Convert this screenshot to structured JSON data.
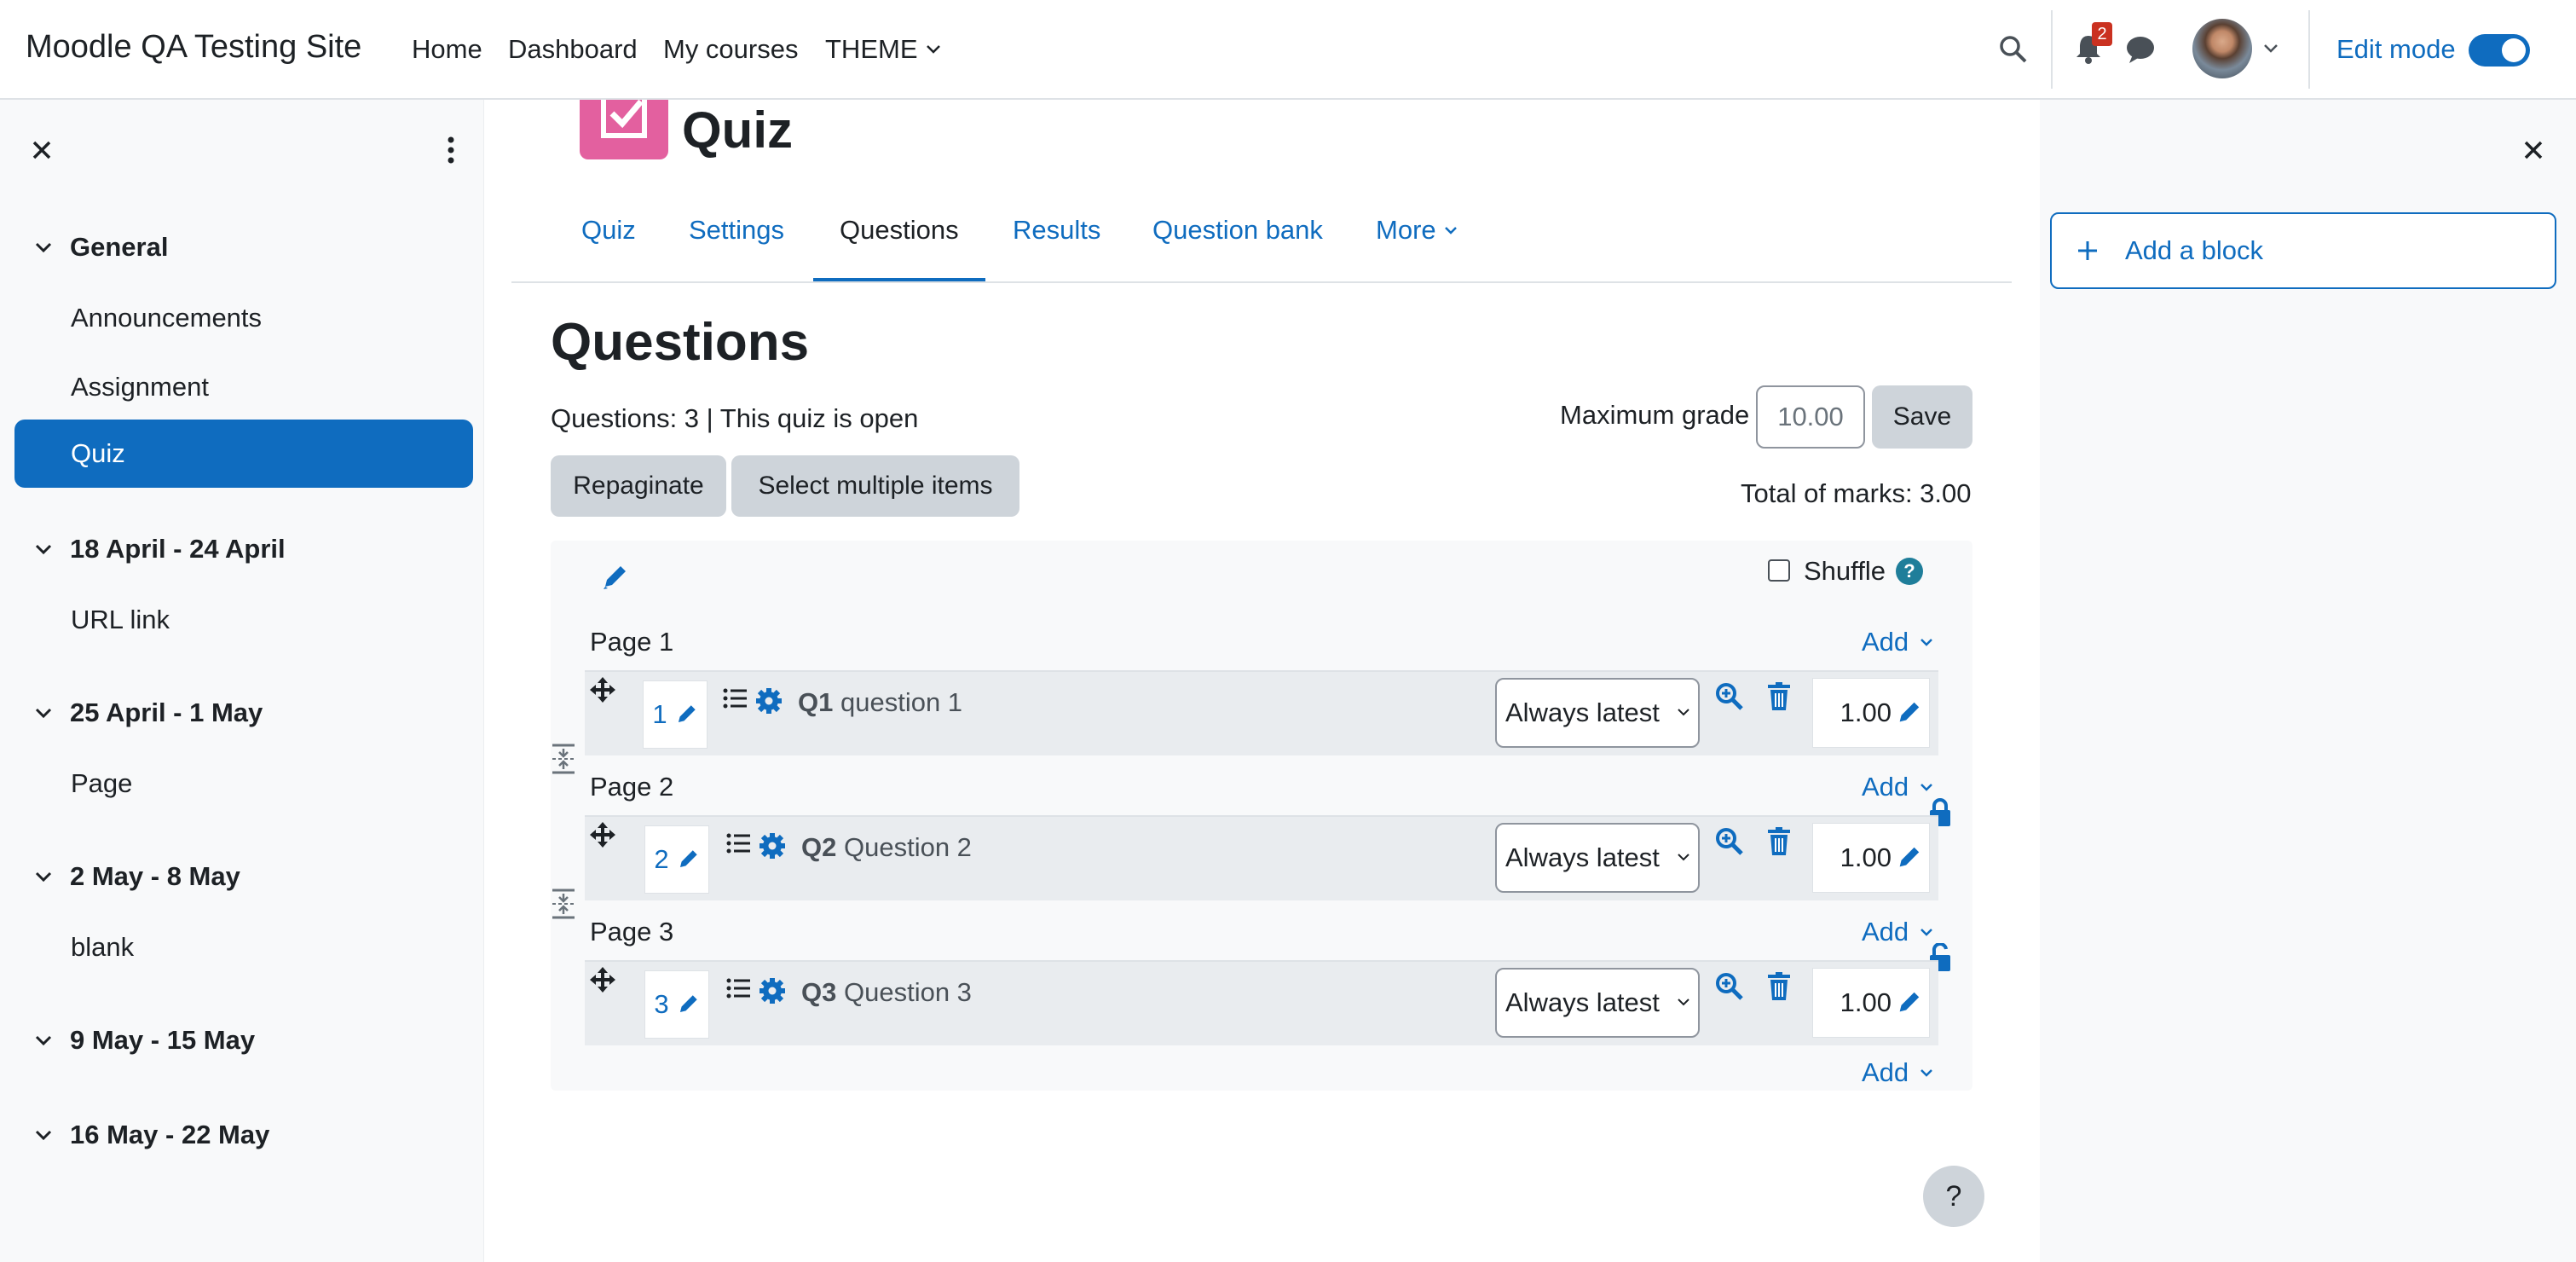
{
  "navbar": {
    "site_name": "Moodle QA Testing Site",
    "links": [
      "Home",
      "Dashboard",
      "My courses",
      "THEME"
    ],
    "notification_count": "2",
    "edit_mode_label": "Edit mode",
    "edit_mode_on": true
  },
  "left_drawer": {
    "sections": [
      {
        "title": "General",
        "activities": [
          "Announcements",
          "Assignment",
          "Quiz"
        ]
      },
      {
        "title": "18 April - 24 April",
        "activities": [
          "URL link"
        ]
      },
      {
        "title": "25 April - 1 May",
        "activities": [
          "Page"
        ]
      },
      {
        "title": "2 May - 8 May",
        "activities": [
          "blank"
        ]
      },
      {
        "title": "9 May - 15 May",
        "activities": []
      },
      {
        "title": "16 May - 22 May",
        "activities": []
      }
    ],
    "active_activity": "Quiz"
  },
  "right_drawer": {
    "add_block_label": "Add a block"
  },
  "activity": {
    "name": "Quiz",
    "icon_color": "#e3609f"
  },
  "tabs": [
    "Quiz",
    "Settings",
    "Questions",
    "Results",
    "Question bank",
    "More"
  ],
  "active_tab": "Questions",
  "page": {
    "heading": "Questions",
    "status_line": "Questions: 3 | This quiz is open",
    "max_grade_label": "Maximum grade",
    "max_grade_value": "10.00",
    "save_label": "Save",
    "repaginate_label": "Repaginate",
    "select_multiple_label": "Select multiple items",
    "total_marks": "Total of marks: 3.00",
    "shuffle_label": "Shuffle",
    "add_label": "Add"
  },
  "pages": [
    {
      "label": "Page 1",
      "question": {
        "number": "1",
        "code": "Q1",
        "name": "question 1",
        "version": "Always latest",
        "mark": "1.00"
      }
    },
    {
      "label": "Page 2",
      "question": {
        "number": "2",
        "code": "Q2",
        "name": "Question 2",
        "version": "Always latest",
        "mark": "1.00"
      }
    },
    {
      "label": "Page 3",
      "question": {
        "number": "3",
        "code": "Q3",
        "name": "Question 3",
        "version": "Always latest",
        "mark": "1.00"
      }
    }
  ],
  "help_label": "?"
}
